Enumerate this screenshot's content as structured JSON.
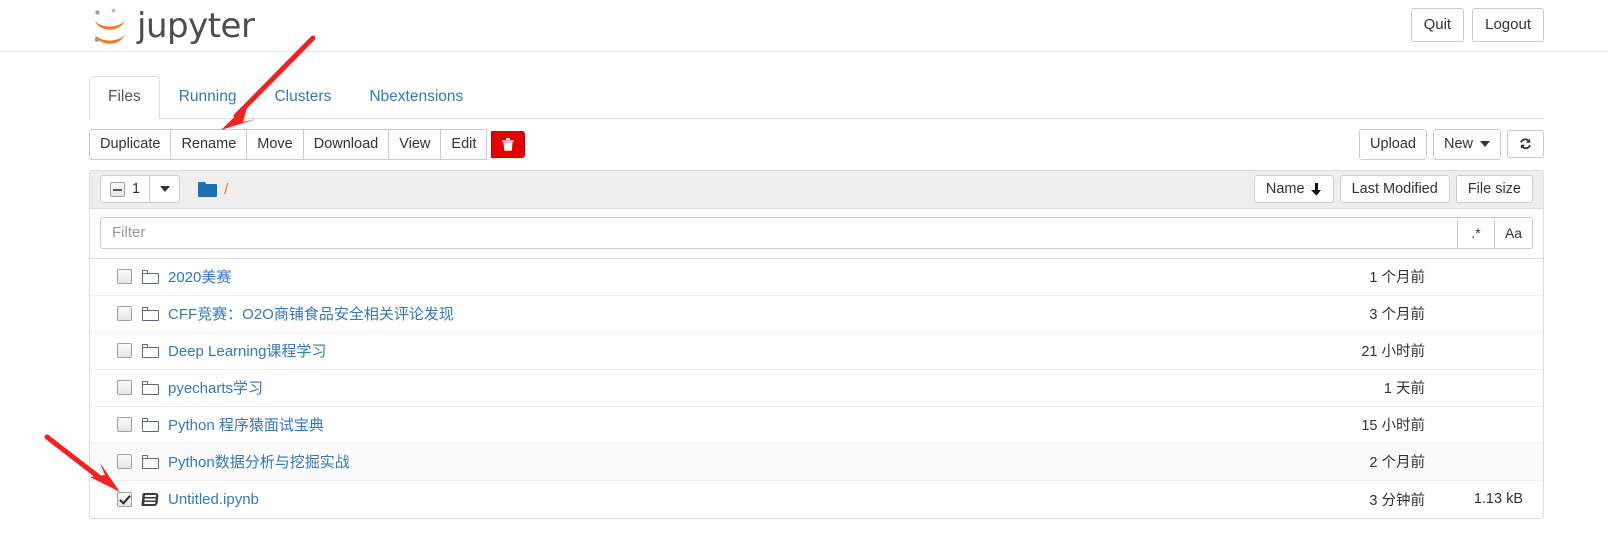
{
  "header": {
    "brand": "jupyter",
    "logo_icon": "jupyter-logo",
    "quit_label": "Quit",
    "logout_label": "Logout"
  },
  "tabs": [
    {
      "label": "Files",
      "active": true
    },
    {
      "label": "Running",
      "active": false
    },
    {
      "label": "Clusters",
      "active": false
    },
    {
      "label": "Nbextensions",
      "active": false
    }
  ],
  "toolbar": {
    "actions": [
      {
        "label": "Duplicate"
      },
      {
        "label": "Rename"
      },
      {
        "label": "Move"
      },
      {
        "label": "Download"
      },
      {
        "label": "View"
      },
      {
        "label": "Edit"
      }
    ],
    "delete_icon": "trash-icon",
    "upload_label": "Upload",
    "new_label": "New",
    "refresh_icon": "refresh-icon"
  },
  "list_toolbar": {
    "selected_count": "1",
    "select_state": "indeterminate",
    "dropdown_icon": "chevron-down-icon",
    "folder_icon": "folder-icon",
    "path": "/",
    "sort": [
      {
        "label": "Name",
        "icon": "arrow-down-icon",
        "arrow": "⬇"
      },
      {
        "label": "Last Modified",
        "icon": "",
        "arrow": ""
      },
      {
        "label": "File size",
        "icon": "",
        "arrow": ""
      }
    ]
  },
  "filter": {
    "value": "",
    "placeholder": "Filter",
    "regex_label": ".*",
    "case_label": "Aa"
  },
  "files": [
    {
      "name": "2020美赛",
      "type": "folder",
      "checked": false,
      "modified": "1 个月前",
      "size": ""
    },
    {
      "name": "CFF竞赛：O2O商铺食品安全相关评论发现",
      "type": "folder",
      "checked": false,
      "modified": "3 个月前",
      "size": ""
    },
    {
      "name": "Deep Learning课程学习",
      "type": "folder",
      "checked": false,
      "modified": "21 小时前",
      "size": ""
    },
    {
      "name": "pyecharts学习",
      "type": "folder",
      "checked": false,
      "modified": "1 天前",
      "size": ""
    },
    {
      "name": "Python 程序猿面试宝典",
      "type": "folder",
      "checked": false,
      "modified": "15 小时前",
      "size": ""
    },
    {
      "name": "Python数据分析与挖掘实战",
      "type": "folder",
      "checked": false,
      "modified": "2 个月前",
      "size": ""
    },
    {
      "name": "Untitled.ipynb",
      "type": "notebook",
      "checked": true,
      "modified": "3 分钟前",
      "size": "1.13 kB"
    }
  ],
  "annotations": {
    "arrow_color": "#f42121",
    "arrow_rename": "arrow-pointing-to-rename-button",
    "arrow_checkbox": "arrow-pointing-to-selected-checkbox"
  }
}
